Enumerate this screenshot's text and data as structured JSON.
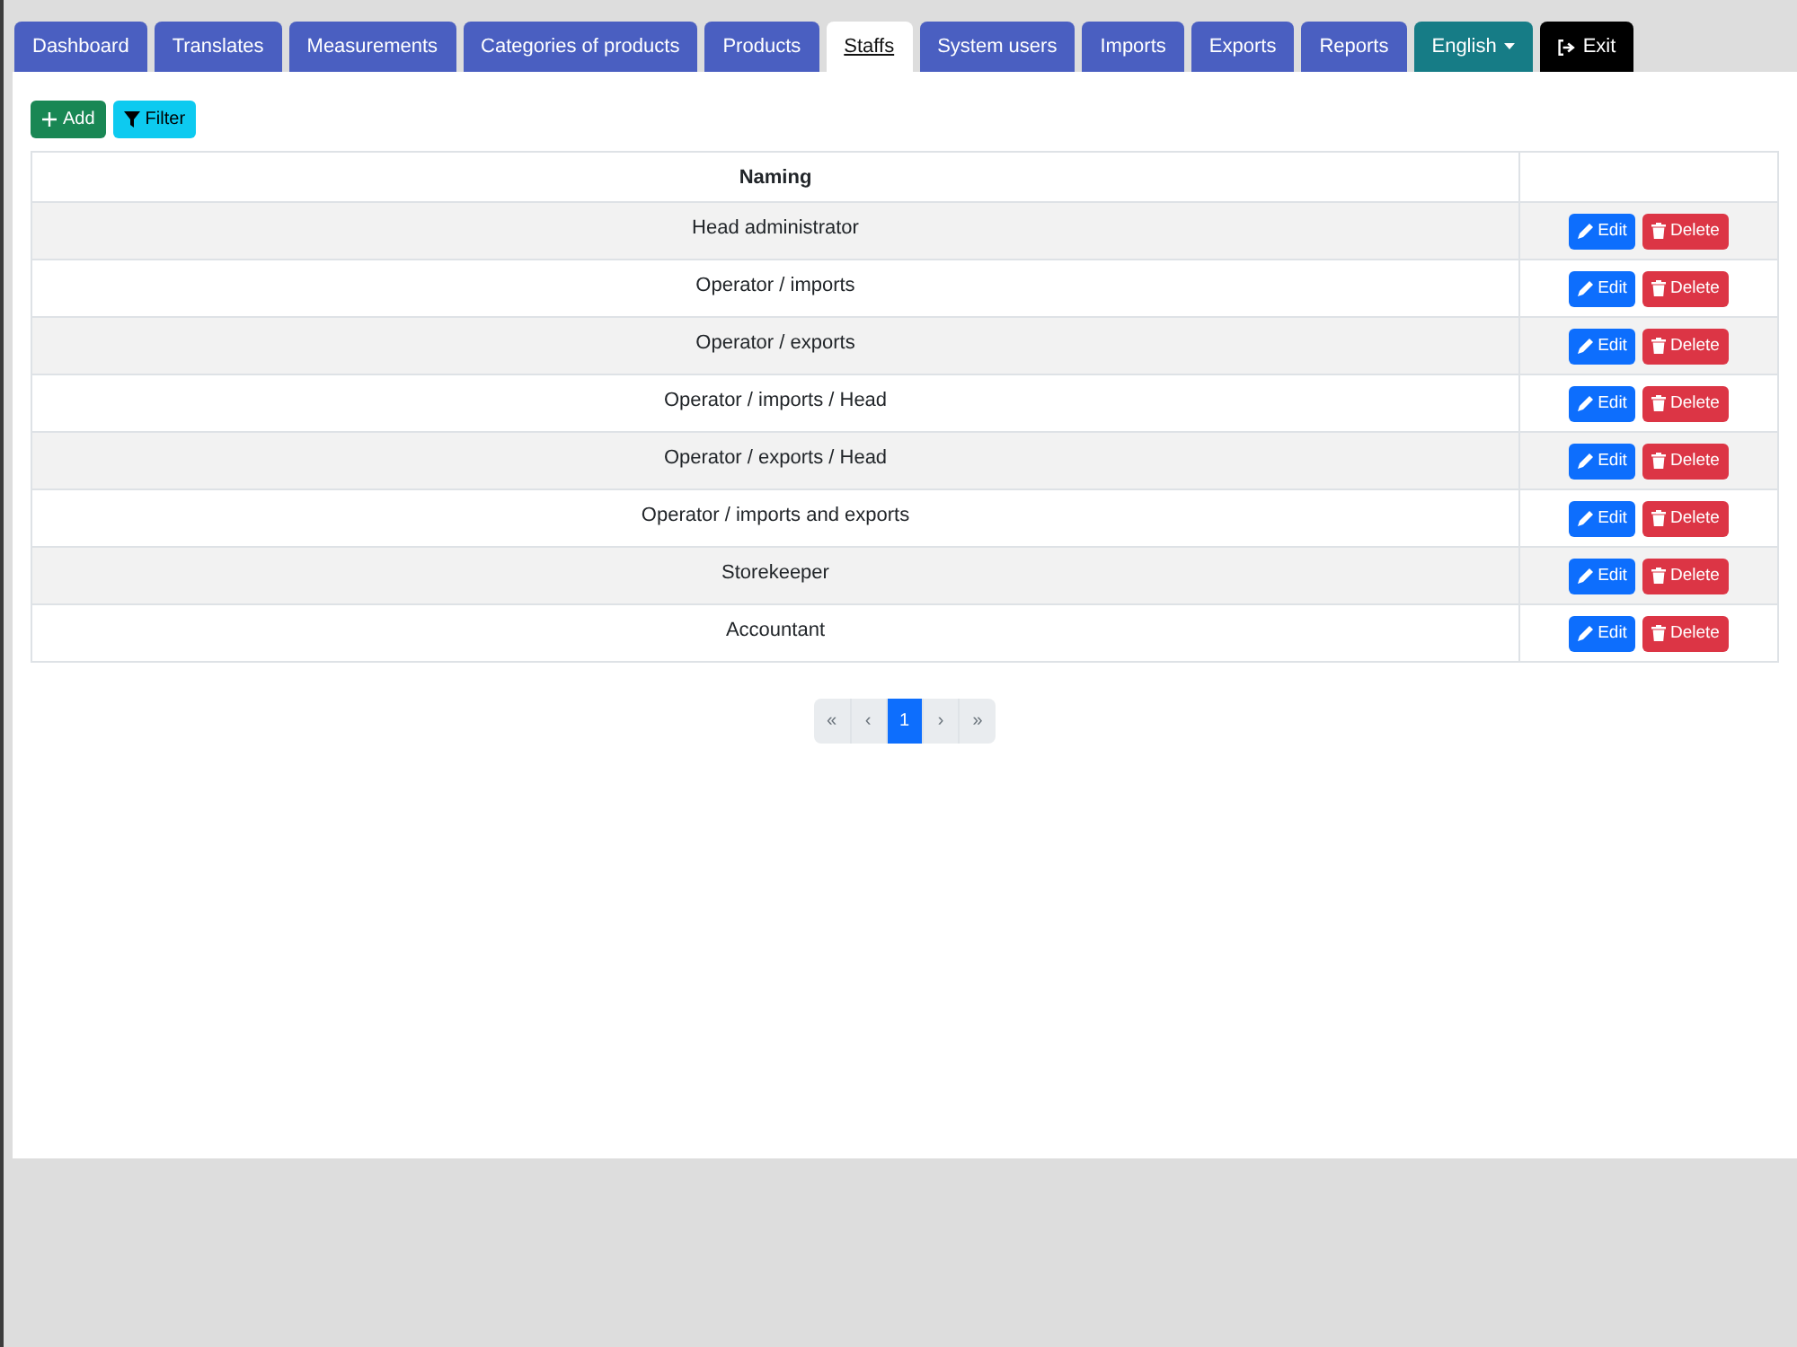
{
  "tabs": [
    {
      "label": "Dashboard",
      "kind": "nav",
      "selected": false
    },
    {
      "label": "Translates",
      "kind": "nav",
      "selected": false
    },
    {
      "label": "Measurements",
      "kind": "nav",
      "selected": false
    },
    {
      "label": "Categories of products",
      "kind": "nav",
      "selected": false
    },
    {
      "label": "Products",
      "kind": "nav",
      "selected": false
    },
    {
      "label": "Staffs",
      "kind": "nav",
      "selected": true
    },
    {
      "label": "System users",
      "kind": "nav",
      "selected": false
    },
    {
      "label": "Imports",
      "kind": "nav",
      "selected": false
    },
    {
      "label": "Exports",
      "kind": "nav",
      "selected": false
    },
    {
      "label": "Reports",
      "kind": "nav",
      "selected": false
    },
    {
      "label": "English",
      "kind": "dropdown",
      "selected": false
    },
    {
      "label": "Exit",
      "kind": "exit",
      "selected": false
    }
  ],
  "toolbar": [
    {
      "label": "Add",
      "kind": "add"
    },
    {
      "label": "Filter",
      "kind": "filter"
    }
  ],
  "table": {
    "columns": [
      "Naming"
    ],
    "rows": [
      {
        "naming": "Head administrator",
        "actions": [
          {
            "label": "Edit",
            "kind": "edit"
          },
          {
            "label": "Delete",
            "kind": "delete"
          }
        ]
      },
      {
        "naming": "Operator / imports",
        "actions": [
          {
            "label": "Edit",
            "kind": "edit"
          },
          {
            "label": "Delete",
            "kind": "delete"
          }
        ]
      },
      {
        "naming": "Operator / exports",
        "actions": [
          {
            "label": "Edit",
            "kind": "edit"
          },
          {
            "label": "Delete",
            "kind": "delete"
          }
        ]
      },
      {
        "naming": "Operator / imports / Head",
        "actions": [
          {
            "label": "Edit",
            "kind": "edit"
          },
          {
            "label": "Delete",
            "kind": "delete"
          }
        ]
      },
      {
        "naming": "Operator / exports / Head",
        "actions": [
          {
            "label": "Edit",
            "kind": "edit"
          },
          {
            "label": "Delete",
            "kind": "delete"
          }
        ]
      },
      {
        "naming": "Operator / imports and exports",
        "actions": [
          {
            "label": "Edit",
            "kind": "edit"
          },
          {
            "label": "Delete",
            "kind": "delete"
          }
        ]
      },
      {
        "naming": "Storekeeper",
        "actions": [
          {
            "label": "Edit",
            "kind": "edit"
          },
          {
            "label": "Delete",
            "kind": "delete"
          }
        ]
      },
      {
        "naming": "Accountant",
        "actions": [
          {
            "label": "Edit",
            "kind": "edit"
          },
          {
            "label": "Delete",
            "kind": "delete"
          }
        ]
      }
    ]
  },
  "pagination": [
    {
      "label": "«",
      "selected": false,
      "disabled": true
    },
    {
      "label": "‹",
      "selected": false,
      "disabled": true
    },
    {
      "label": "1",
      "selected": true,
      "disabled": false
    },
    {
      "label": "›",
      "selected": false,
      "disabled": true
    },
    {
      "label": "»",
      "selected": false,
      "disabled": true
    }
  ]
}
